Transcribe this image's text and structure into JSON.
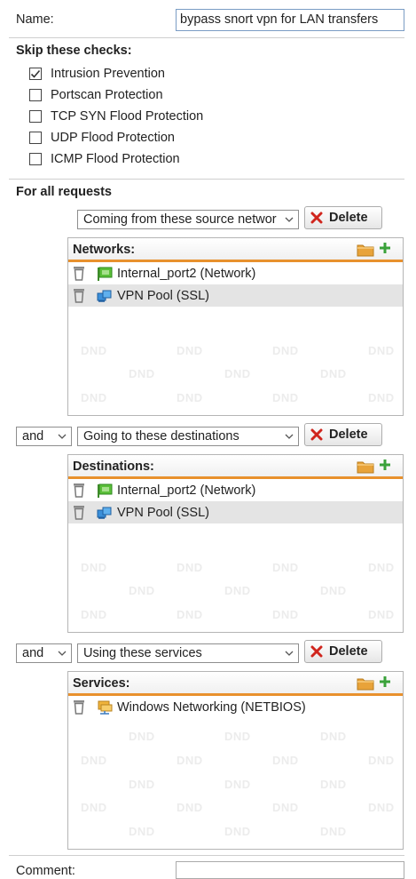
{
  "name": {
    "label": "Name:",
    "value": "bypass snort vpn for LAN transfers"
  },
  "skip": {
    "title": "Skip these checks:",
    "items": [
      {
        "label": "Intrusion Prevention",
        "checked": true
      },
      {
        "label": "Portscan Protection",
        "checked": false
      },
      {
        "label": "TCP SYN Flood Protection",
        "checked": false
      },
      {
        "label": "UDP Flood Protection",
        "checked": false
      },
      {
        "label": "ICMP Flood Protection",
        "checked": false
      }
    ]
  },
  "requests": {
    "title": "For all requests",
    "delete_label": "Delete",
    "dnd_text": "DND",
    "blocks": [
      {
        "selector": "Coming from these source networ",
        "panel_title": "Networks:",
        "items": [
          {
            "label": "Internal_port2 (Network)",
            "icon": "network-green-icon",
            "selected": false
          },
          {
            "label": "VPN Pool (SSL)",
            "icon": "vpn-pool-icon",
            "selected": true
          }
        ]
      },
      {
        "conjunction": "and",
        "selector": "Going to these destinations",
        "panel_title": "Destinations:",
        "items": [
          {
            "label": "Internal_port2 (Network)",
            "icon": "network-green-icon",
            "selected": false
          },
          {
            "label": "VPN Pool (SSL)",
            "icon": "vpn-pool-icon",
            "selected": true
          }
        ]
      },
      {
        "conjunction": "and",
        "selector": "Using these services",
        "panel_title": "Services:",
        "items": [
          {
            "label": "Windows Networking (NETBIOS)",
            "icon": "service-group-icon",
            "selected": false
          }
        ]
      }
    ]
  },
  "comment": {
    "label": "Comment:"
  },
  "colors": {
    "accent": "#e8912d",
    "selected_row": "#e4e4e4",
    "delete_x": "#d0251d",
    "add_plus": "#3aa23a"
  }
}
